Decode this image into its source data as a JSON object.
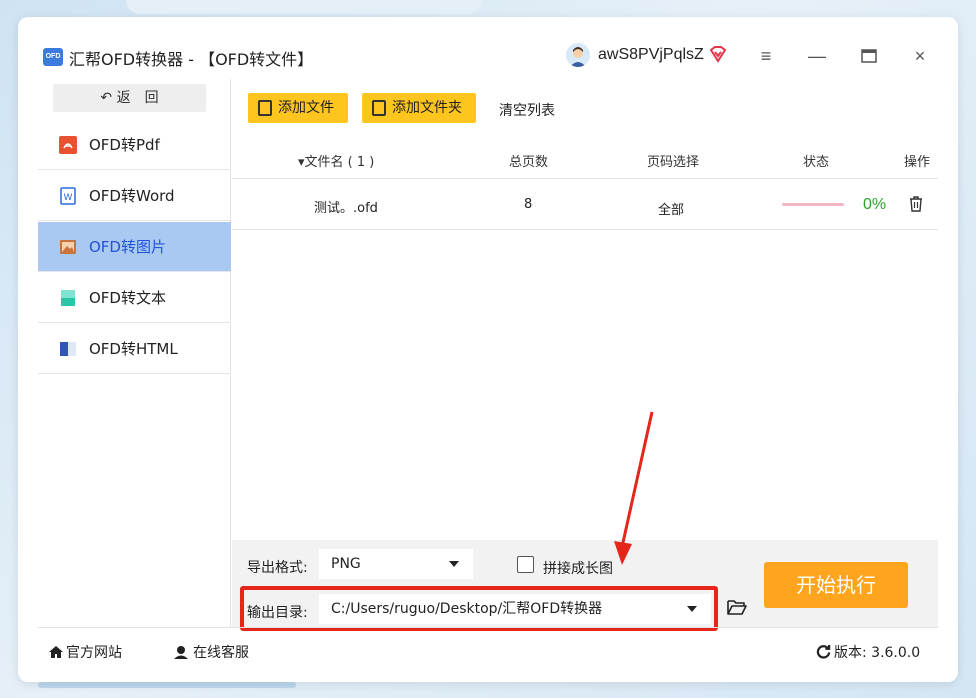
{
  "window": {
    "logo_text": "OFD",
    "title": "汇帮OFD转换器 - 【OFD转文件】",
    "username": "awS8PVjPqlsZ",
    "controls": {
      "menu": "≡",
      "minimize": "—",
      "maximize": "☐",
      "close": "×"
    }
  },
  "sidebar": {
    "back_label": "↶ 返　回",
    "items": [
      {
        "label": "OFD转Pdf",
        "icon": "pdf-icon",
        "color": "#e8522f"
      },
      {
        "label": "OFD转Word",
        "icon": "word-icon",
        "color": "#2b6ad6"
      },
      {
        "label": "OFD转图片",
        "icon": "image-icon",
        "color": "#c9743a",
        "active": true
      },
      {
        "label": "OFD转文本",
        "icon": "text-file-icon",
        "color": "#2bc6a8"
      },
      {
        "label": "OFD转HTML",
        "icon": "html-icon",
        "color": "#2f56b5"
      }
    ]
  },
  "toolbar": {
    "add_file": "添加文件",
    "add_folder": "添加文件夹",
    "clear_list": "清空列表"
  },
  "table": {
    "headers": {
      "filename": "▾文件名 ( 1 )",
      "pages": "总页数",
      "page_select": "页码选择",
      "status": "状态",
      "action": "操作"
    },
    "rows": [
      {
        "filename": "测试。.ofd",
        "pages": "8",
        "page_select": "全部",
        "progress": "0%"
      }
    ]
  },
  "options": {
    "format_label": "导出格式:",
    "format_value": "PNG",
    "stitch_label": "拼接成长图",
    "stitch_checked": false,
    "output_label": "输出目录:",
    "output_value": "C:/Users/ruguo/Desktop/汇帮OFD转换器",
    "start_button": "开始执行"
  },
  "footer": {
    "website": "官方网站",
    "support": "在线客服",
    "version": "版本:  3.6.0.0"
  },
  "colors": {
    "accent_yellow": "#ffc51f",
    "start_orange": "#ffa41d",
    "active_blue": "#a9c8f2",
    "highlight_red": "#e4261b",
    "progress_green": "#2aa52a"
  }
}
